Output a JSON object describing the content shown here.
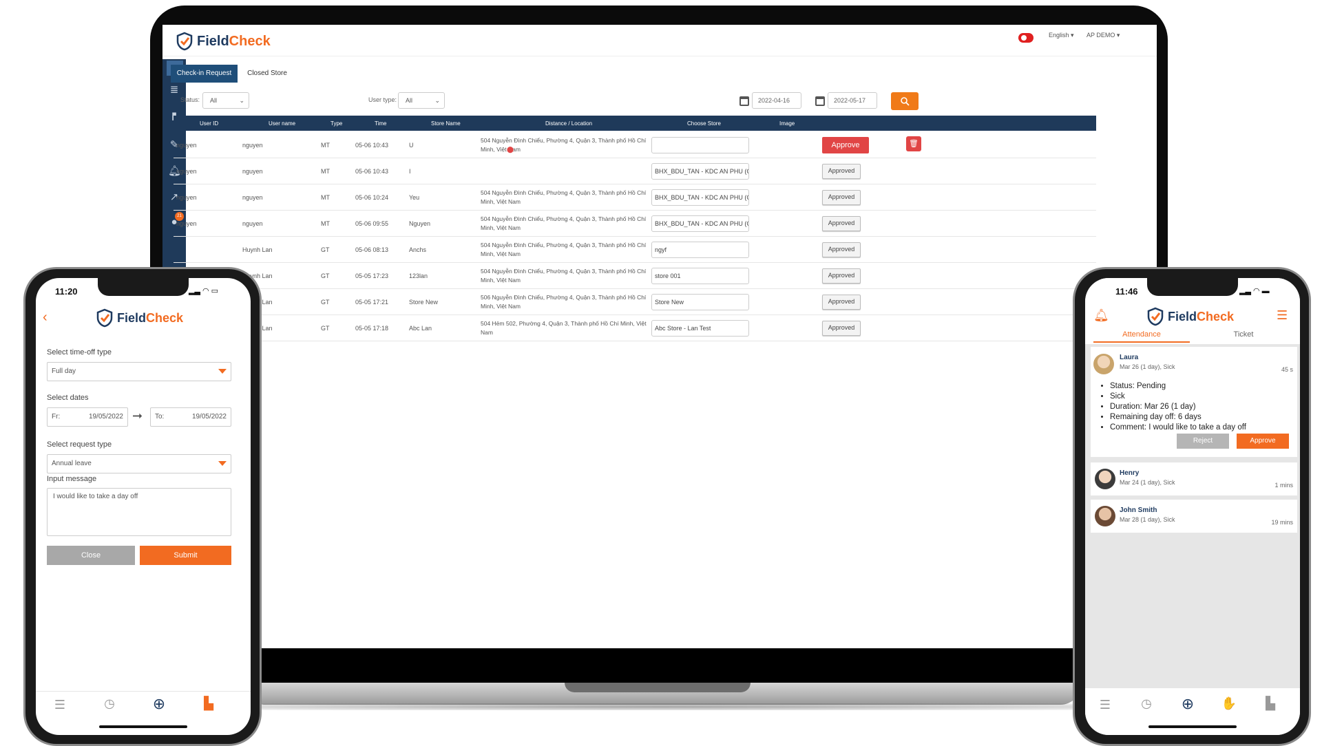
{
  "brand": {
    "field": "Field",
    "check": "Check"
  },
  "web": {
    "header": {
      "language": "English",
      "user": "AP DEMO"
    },
    "tabs": [
      "Check-in Request",
      "Closed Store"
    ],
    "filters": {
      "status_label": "Status:",
      "status_value": "All",
      "usertype_label": "User type:",
      "usertype_value": "All",
      "date_from": "2022-04-16",
      "date_to": "2022-05-17"
    },
    "sidebar_badge": "21",
    "columns": [
      "User ID",
      "User name",
      "Type",
      "Time",
      "Store Name",
      "Distance / Location",
      "Choose Store",
      "Image"
    ],
    "rows": [
      {
        "user_id": "nguyen",
        "user_name": "nguyen",
        "type": "MT",
        "time": "05-06 10:43",
        "store": "U",
        "location": "504 Nguyễn Đình Chiểu, Phường 4, Quận 3, Thành phố Hồ Chí Minh, Việt Nam",
        "choose_store": "",
        "action": "Approve"
      },
      {
        "user_id": "nguyen",
        "user_name": "nguyen",
        "type": "MT",
        "time": "05-06 10:43",
        "store": "I",
        "location": "",
        "choose_store": "BHX_BDU_TAN - KDC AN PHU (CHC",
        "action": "Approved"
      },
      {
        "user_id": "nguyen",
        "user_name": "nguyen",
        "type": "MT",
        "time": "05-06 10:24",
        "store": "Yeu",
        "location": "504 Nguyễn Đình Chiểu, Phường 4, Quận 3, Thành phố Hồ Chí Minh, Việt Nam",
        "choose_store": "BHX_BDU_TAN - KDC AN PHU (CHC",
        "action": "Approved"
      },
      {
        "user_id": "nguyen",
        "user_name": "nguyen",
        "type": "MT",
        "time": "05-06 09:55",
        "store": "Nguyen",
        "location": "504 Nguyễn Đình Chiểu, Phường 4, Quận 3, Thành phố Hồ Chí Minh, Việt Nam",
        "choose_store": "BHX_BDU_TAN - KDC AN PHU (CHC",
        "action": "Approved"
      },
      {
        "user_id": "",
        "user_name": "Huynh Lan",
        "type": "GT",
        "time": "05-06 08:13",
        "store": "Anchs",
        "location": "504 Nguyễn Đình Chiểu, Phường 4, Quận 3, Thành phố Hồ Chí Minh, Việt Nam",
        "choose_store": "ngyf",
        "action": "Approved"
      },
      {
        "user_id": "",
        "user_name": "Huynh Lan",
        "type": "GT",
        "time": "05-05 17:23",
        "store": "123lan",
        "location": "504 Nguyễn Đình Chiểu, Phường 4, Quận 3, Thành phố Hồ Chí Minh, Việt Nam",
        "choose_store": "store 001",
        "action": "Approved"
      },
      {
        "user_id": "",
        "user_name": "Huynh Lan",
        "type": "GT",
        "time": "05-05 17:21",
        "store": "Store New",
        "location": "506 Nguyễn Đình Chiểu, Phường 4, Quận 3, Thành phố Hồ Chí Minh, Việt Nam",
        "choose_store": "Store New",
        "action": "Approved"
      },
      {
        "user_id": "",
        "user_name": "Huynh Lan",
        "type": "GT",
        "time": "05-05 17:18",
        "store": "Abc Lan",
        "location": "504 Hẻm 502, Phường 4, Quận 3, Thành phố Hồ Chí Minh, Việt Nam",
        "choose_store": "Abc Store - Lan Test",
        "action": "Approved"
      }
    ]
  },
  "left_phone": {
    "time": "11:20",
    "timeoff_label": "Select time-off type",
    "timeoff_value": "Full day",
    "dates_label": "Select dates",
    "from_prefix": "Fr:",
    "from_value": "19/05/2022",
    "to_prefix": "To:",
    "to_value": "19/05/2022",
    "request_label": "Select request type",
    "request_value": "Annual leave",
    "message_label": "Input message",
    "message_value": "I would like to take a day off",
    "close_label": "Close",
    "submit_label": "Submit"
  },
  "right_phone": {
    "time": "11:46",
    "tabs": [
      "Attendance",
      "Ticket"
    ],
    "requests": [
      {
        "name": "Laura",
        "sub": "Mar 26 (1 day), Sick",
        "ago": "45 s"
      },
      {
        "name": "Henry",
        "sub": "Mar 24 (1 day), Sick",
        "ago": "1 mins"
      },
      {
        "name": "John Smith",
        "sub": "Mar 28 (1 day), Sick",
        "ago": "19 mins"
      }
    ],
    "details": [
      "Status: Pending",
      "Sick",
      "Duration: Mar 26 (1 day)",
      "Remaining day off: 6 days",
      "Comment: I would like to take a day off"
    ],
    "reject_label": "Reject",
    "approve_label": "Approve"
  },
  "colors": {
    "brand_blue": "#1e3a5f",
    "brand_orange": "#f26b21",
    "approve_red": "#e14545",
    "search_orange": "#f07a18"
  }
}
